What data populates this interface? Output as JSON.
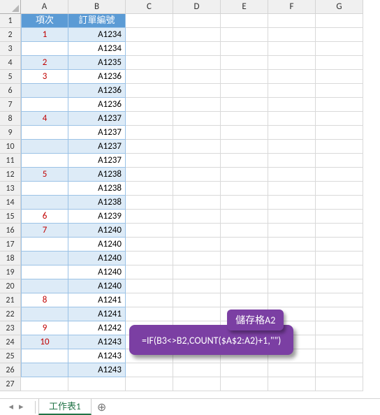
{
  "columns": [
    "A",
    "B",
    "C",
    "D",
    "E",
    "F",
    "G"
  ],
  "headers": {
    "A": "項次",
    "B": "訂單編號"
  },
  "row_count": 27,
  "rows": [
    {
      "a": "1",
      "b": "A1234"
    },
    {
      "a": "",
      "b": "A1234"
    },
    {
      "a": "2",
      "b": "A1235"
    },
    {
      "a": "3",
      "b": "A1236"
    },
    {
      "a": "",
      "b": "A1236"
    },
    {
      "a": "",
      "b": "A1236"
    },
    {
      "a": "4",
      "b": "A1237"
    },
    {
      "a": "",
      "b": "A1237"
    },
    {
      "a": "",
      "b": "A1237"
    },
    {
      "a": "",
      "b": "A1237"
    },
    {
      "a": "5",
      "b": "A1238"
    },
    {
      "a": "",
      "b": "A1238"
    },
    {
      "a": "",
      "b": "A1238"
    },
    {
      "a": "6",
      "b": "A1239"
    },
    {
      "a": "7",
      "b": "A1240"
    },
    {
      "a": "",
      "b": "A1240"
    },
    {
      "a": "",
      "b": "A1240"
    },
    {
      "a": "",
      "b": "A1240"
    },
    {
      "a": "",
      "b": "A1240"
    },
    {
      "a": "8",
      "b": "A1241"
    },
    {
      "a": "",
      "b": "A1241"
    },
    {
      "a": "9",
      "b": "A1242"
    },
    {
      "a": "10",
      "b": "A1243"
    },
    {
      "a": "",
      "b": "A1243"
    },
    {
      "a": "",
      "b": "A1243"
    }
  ],
  "callout": {
    "label": "儲存格A2",
    "formula": "=IF(B3<>B2,COUNT($A$2:A2)+1,\"\")"
  },
  "sheet_tab": "工作表1",
  "nav": {
    "prev": "◂",
    "next": "▸",
    "add": "⊕"
  }
}
